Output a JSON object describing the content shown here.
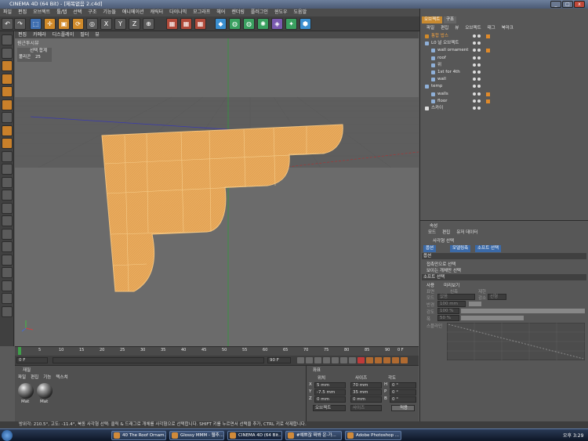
{
  "window": {
    "title": "CINEMA 4D (64 Bit) - [제목없음 2.c4d]",
    "minimize": "_",
    "maximize": "□",
    "close": "x"
  },
  "menubar": [
    "파일",
    "편집",
    "오브젝트",
    "툴/탭",
    "선택",
    "구조",
    "기능들",
    "애니메이션",
    "캐릭터",
    "다이나믹",
    "모그라프",
    "헤어",
    "렌더링",
    "플러그인",
    "윈도우",
    "도움말"
  ],
  "toolbar": {
    "icons": [
      "undo-icon",
      "redo-icon",
      "select-icon",
      "move-icon",
      "scale-icon",
      "rotate-icon",
      "live-select-icon",
      "x-axis-icon",
      "y-axis-icon",
      "z-axis-icon",
      "world-icon",
      "render-view-icon",
      "render-picture-icon",
      "render-settings-icon",
      "cube-icon",
      "nurbs-icon",
      "array-icon",
      "deformer-icon",
      "scene-icon",
      "light-icon",
      "camera-icon"
    ]
  },
  "viewport": {
    "menu": [
      "편집",
      "카메라",
      "디스플레이",
      "필터",
      "뷰"
    ],
    "label": "원근투시뷰",
    "stats_label": "선택 합계",
    "stats_polygons_label": "폴리곤",
    "stats_polygons_value": "25"
  },
  "timeline": {
    "ticks": [
      "0",
      "5",
      "10",
      "15",
      "20",
      "25",
      "30",
      "35",
      "40",
      "45",
      "50",
      "55",
      "60",
      "65",
      "70",
      "75",
      "80",
      "85",
      "90"
    ],
    "end_frame": "0 F",
    "current_frame": "0 F",
    "start_field": "0 F",
    "end_field": "90 F",
    "max_field": "90 F"
  },
  "materials": {
    "title": "재질",
    "menu": [
      "파일",
      "편집",
      "기능",
      "텍스쳐"
    ],
    "items": [
      "Mat",
      "Mat"
    ]
  },
  "coordinates": {
    "title": "좌표",
    "headers": [
      "위치",
      "사이즈",
      "각도"
    ],
    "rows": [
      {
        "axis": "X",
        "position": "5 mm",
        "size": "70 mm",
        "angle_axis": "H",
        "angle": "0 °"
      },
      {
        "axis": "Y",
        "position": "-7.5 mm",
        "size": "35 mm",
        "angle_axis": "P",
        "angle": "0 °"
      },
      {
        "axis": "Z",
        "position": "0 mm",
        "size": "0 mm",
        "angle_axis": "B",
        "angle": "0 °"
      }
    ],
    "mode_select": "오브젝트",
    "size_select": "사이즈",
    "apply_button": "적용"
  },
  "object_manager": {
    "tabs": [
      "오브젝트",
      "구조"
    ],
    "menu": [
      "파일",
      "편집",
      "뷰",
      "오브젝트",
      "태그",
      "북마크"
    ],
    "objects": [
      {
        "name": "통합 밥스",
        "indent": 0
      },
      {
        "name": "L0 널 오브젝트",
        "indent": 0
      },
      {
        "name": "wall ornament",
        "indent": 1
      },
      {
        "name": "roof",
        "indent": 1
      },
      {
        "name": "위",
        "indent": 1
      },
      {
        "name": "1st for 4th",
        "indent": 1
      },
      {
        "name": "wall",
        "indent": 1
      },
      {
        "name": "temp",
        "indent": 0
      },
      {
        "name": "walls",
        "indent": 1
      },
      {
        "name": "floor",
        "indent": 1
      },
      {
        "name": "스카이",
        "indent": 0
      }
    ]
  },
  "attributes": {
    "title": "속성",
    "menu": [
      "모드",
      "편집",
      "유저 데이터"
    ],
    "tool_name": "사각형 선택",
    "tabs": [
      "옵션",
      "모델링축",
      "소프트 선택"
    ],
    "options_section": "옵션",
    "option1": "접촉만으로 선택",
    "option2": "보이는 개체만 선택",
    "soft_section": "소프트 선택",
    "use_label": "사용",
    "preview_label": "미리보기",
    "surface_label": "표면",
    "rubber_label": "신축",
    "restrict_label": "제한",
    "mode_label": "모드",
    "mode_value": "없음",
    "falloff_label": "감소",
    "falloff_value": "선형",
    "radius_label": "반경",
    "radius_value": "100 mm",
    "strength_label": "강도",
    "strength_value": "100 %",
    "width_label": "폭",
    "width_value": "50 %",
    "spline_label": "스플라인"
  },
  "statusbar": "방위각: 210.5°, 고도: -11.4°, 북동   사각형 선택: 클릭 & 드래그로 개체를 사각형으로 선택합니다. SHIFT 키를 누르면서 선택을 추가, CTRL 키로 삭제합니다.",
  "taskbar": {
    "items": [
      "40 The Roof Ornam...",
      "Glossy MMM - 웹추...",
      "CINEMA 4D (64 Bit...",
      "#예쁘잖 짜봐 운-가...",
      "Adobe Photoshop ..."
    ],
    "clock": "오후 3:29"
  },
  "colors": {
    "mesh_fill": "#e9a85a",
    "mesh_wire": "#f2c27a",
    "accent": "#e08a2a",
    "selection_blue": "#5a8fd0"
  }
}
